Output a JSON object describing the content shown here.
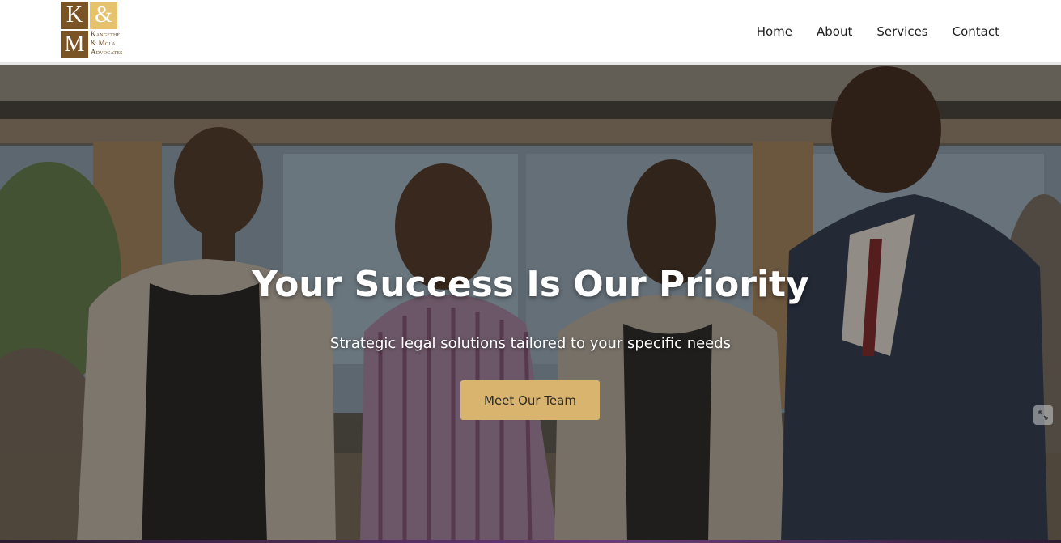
{
  "logo": {
    "letter_k": "K",
    "ampersand": "&",
    "letter_m": "M",
    "line1": "Kangethe",
    "line2": "& Mola",
    "line3": "Advocates"
  },
  "nav": {
    "items": [
      "Home",
      "About",
      "Services",
      "Contact"
    ]
  },
  "hero": {
    "title": "Your Success Is Our Priority",
    "subtitle": "Strategic legal solutions tailored to your specific needs",
    "button_label": "Meet Our Team"
  },
  "colors": {
    "brand_brown": "#7b5426",
    "brand_gold": "#e7c26d",
    "button_gold": "#d8b46f"
  },
  "icons": {
    "scroll": "expand-arrows-icon"
  }
}
